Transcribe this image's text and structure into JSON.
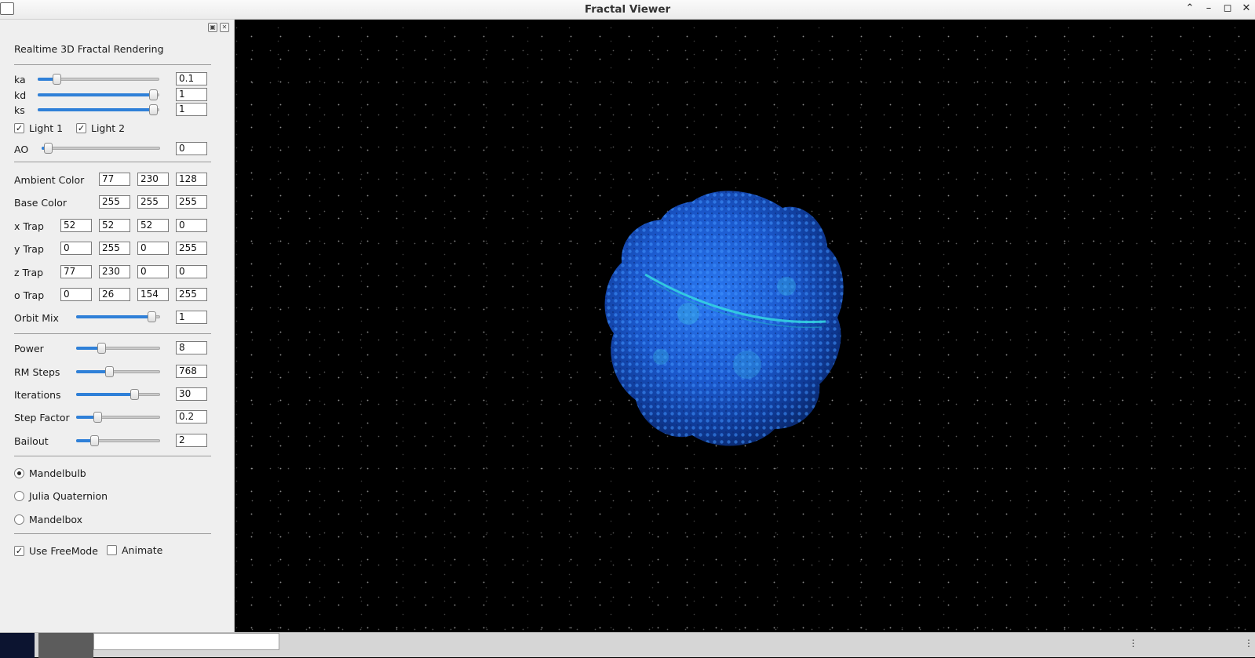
{
  "window": {
    "title": "Fractal Viewer",
    "controls": [
      "chevron-up-icon",
      "minimize-icon",
      "maximize-icon",
      "close-icon"
    ]
  },
  "panel": {
    "heading": "Realtime 3D Fractal Rendering",
    "lighting": [
      {
        "label": "ka",
        "value": "0.1",
        "slider_fraction": 0.13
      },
      {
        "label": "kd",
        "value": "1",
        "slider_fraction": 0.98
      },
      {
        "label": "ks",
        "value": "1",
        "slider_fraction": 0.98
      }
    ],
    "lights": [
      {
        "label": "Light 1",
        "checked": true
      },
      {
        "label": "Light 2",
        "checked": true
      }
    ],
    "ao": {
      "label": "AO",
      "value": "0",
      "slider_fraction": 0.02
    },
    "colors": [
      {
        "label": "Ambient Color",
        "values": [
          "77",
          "230",
          "128"
        ]
      },
      {
        "label": "Base Color",
        "values": [
          "255",
          "255",
          "255"
        ]
      }
    ],
    "traps": [
      {
        "label": "x Trap",
        "values": [
          "52",
          "52",
          "52",
          "0"
        ]
      },
      {
        "label": "y Trap",
        "values": [
          "0",
          "255",
          "0",
          "255"
        ]
      },
      {
        "label": "z Trap",
        "values": [
          "77",
          "230",
          "0",
          "0"
        ]
      },
      {
        "label": "o Trap",
        "values": [
          "0",
          "26",
          "154",
          "255"
        ]
      }
    ],
    "orbit_mix": {
      "label": "Orbit Mix",
      "value": "1",
      "slider_fraction": 0.94
    },
    "params": [
      {
        "label": "Power",
        "value": "8",
        "slider_fraction": 0.28
      },
      {
        "label": "RM Steps",
        "value": "768",
        "slider_fraction": 0.38
      },
      {
        "label": "Iterations",
        "value": "30",
        "slider_fraction": 0.71
      },
      {
        "label": "Step Factor",
        "value": "0.2",
        "slider_fraction": 0.23
      },
      {
        "label": "Bailout",
        "value": "2",
        "slider_fraction": 0.19
      }
    ],
    "fractal_types": [
      {
        "label": "Mandelbulb",
        "selected": true
      },
      {
        "label": "Julia Quaternion",
        "selected": false
      },
      {
        "label": "Mandelbox",
        "selected": false
      }
    ],
    "options": [
      {
        "label": "Use FreeMode",
        "checked": true
      },
      {
        "label": "Animate",
        "checked": false
      }
    ]
  },
  "colors": {
    "slider_fill": "#2f80d8",
    "fractal_main": "#1c5fd6",
    "fractal_highlight": "#35d8e0",
    "background": "#000000"
  }
}
